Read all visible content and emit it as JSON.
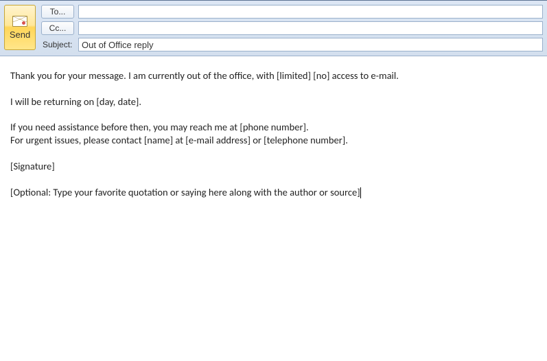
{
  "compose": {
    "send_label": "Send",
    "to_label": "To...",
    "cc_label": "Cc...",
    "subject_label": "Subject:",
    "to_value": "",
    "cc_value": "",
    "subject_value": "Out of Office reply",
    "body_lines": [
      "Thank you for your message. I am currently out of the office, with [limited] [no] access to e-mail.",
      "",
      "I will be returning on [day, date].",
      "",
      "If you need assistance before then, you may reach me at [phone number].",
      "For urgent issues, please contact [name] at [e-mail address] or [telephone number].",
      "",
      "[Signature]",
      "",
      "[Optional: Type your favorite quotation or saying here along with the author or source]"
    ]
  }
}
